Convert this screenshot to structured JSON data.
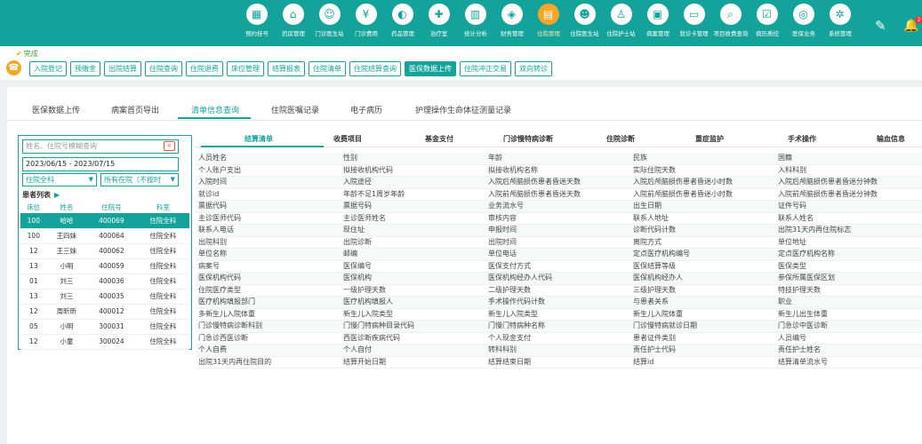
{
  "nav": [
    {
      "label": "预约挂号",
      "icon": "calendar-icon"
    },
    {
      "label": "药房管理",
      "icon": "pharmacy-icon"
    },
    {
      "label": "门诊医生站",
      "icon": "doctor-icon"
    },
    {
      "label": "门诊费用",
      "icon": "fee-icon"
    },
    {
      "label": "药品管理",
      "icon": "pill-icon"
    },
    {
      "label": "治疗室",
      "icon": "treatment-icon"
    },
    {
      "label": "统计分析",
      "icon": "chart-icon"
    },
    {
      "label": "财务管理",
      "icon": "finance-icon"
    },
    {
      "label": "住院管理",
      "icon": "inpatient-icon",
      "active": true
    },
    {
      "label": "住院医生站",
      "icon": "inpatient-doctor-icon"
    },
    {
      "label": "住院护士站",
      "icon": "nurse-icon"
    },
    {
      "label": "病案管理",
      "icon": "record-icon"
    },
    {
      "label": "就诊卡管理",
      "icon": "card-icon"
    },
    {
      "label": "项目收费查询",
      "icon": "query-icon"
    },
    {
      "label": "病历质控",
      "icon": "quality-icon"
    },
    {
      "label": "医保业务",
      "icon": "insurance-icon"
    },
    {
      "label": "系统管理",
      "icon": "settings-icon"
    }
  ],
  "topbar": {
    "badge": "2"
  },
  "toolbar": {
    "status": "完成",
    "buttons": [
      "入院登记",
      "预缴金",
      "出院结算",
      "住院查询",
      "住院退费",
      "床位管理",
      "结算报表",
      "住院清单",
      "住院结算查询",
      "医保数据上传",
      "住院冲正交易",
      "双向转诊"
    ],
    "active_index": 9
  },
  "subtabs": [
    "医保数据上传",
    "病案首页导出",
    "清单信息查询",
    "住院医嘱记录",
    "电子病历",
    "护理操作生命体征测量记录"
  ],
  "subtab_active": 2,
  "left": {
    "search_placeholder": "姓名、住院号模糊查询",
    "date_range": "2023/06/15 - 2023/07/15",
    "dept_select": "住院全科",
    "status_select": "所有在院（不按时",
    "list_title": "患者列表",
    "columns": [
      "床位",
      "姓名",
      "住院号",
      "科室"
    ],
    "rows": [
      [
        "100",
        "哈哈",
        "400069",
        "住院全科"
      ],
      [
        "100",
        "王四妹",
        "400064",
        "住院全科"
      ],
      [
        "12",
        "王三妹",
        "400062",
        "住院全科"
      ],
      [
        "13",
        "小明",
        "400059",
        "住院全科"
      ],
      [
        "01",
        "刘三",
        "400036",
        "住院全科"
      ],
      [
        "13",
        "刘三",
        "400035",
        "住院全科"
      ],
      [
        "12",
        "周昕昕",
        "400012",
        "住院全科"
      ],
      [
        "05",
        "小明",
        "300031",
        "住院全科"
      ],
      [
        "12",
        "小童",
        "300024",
        "住院全科"
      ]
    ],
    "selected_row": 0
  },
  "grid_tabs": [
    "结算清单",
    "收费项目",
    "基金支付",
    "门诊慢特病诊断",
    "住院诊断",
    "重症监护",
    "手术操作",
    "输血信息"
  ],
  "grid_tab_active": 0,
  "grid_rows": [
    [
      "人员姓名",
      "性别",
      "年龄",
      "民族",
      "国籍"
    ],
    [
      "个人账户支出",
      "拟接收机构代码",
      "拟接收机构名称",
      "实际住院天数",
      "入科科别"
    ],
    [
      "入院时间",
      "入院途径",
      "入院后颅脑损伤患者昏迷天数",
      "入院后颅脑损伤患者昏迷小时数",
      "入院后颅脑损伤患者昏迷分钟数"
    ],
    [
      "就诊id",
      "年龄不足1周岁年龄",
      "入院前颅脑损伤患者昏迷天数",
      "入院前颅脑损伤患者昏迷小时数",
      "入院前颅脑损伤患者昏迷分钟数"
    ],
    [
      "票据代码",
      "票据号码",
      "业务流水号",
      "出生日期",
      "证件号码"
    ],
    [
      "主诊医师代码",
      "主诊医师姓名",
      "审核内容",
      "联系人地址",
      "联系人姓名"
    ],
    [
      "联系人电话",
      "现住址",
      "申报时间",
      "诊断代码计数",
      "出院31天内再住院标志"
    ],
    [
      "出院科别",
      "出院诊断",
      "出院时间",
      "离院方式",
      "单位地址"
    ],
    [
      "单位名称",
      "邮编",
      "单位电话",
      "定点医疗机构编号",
      "定点医疗机构名称"
    ],
    [
      "病案号",
      "医保编号",
      "医保支付方式",
      "医保结算等级",
      "医保类型"
    ],
    [
      "医保机构代码",
      "医保机构",
      "医保机构经办人代码",
      "医保机构经办人",
      "参保所属医保区划"
    ],
    [
      "住院医疗类型",
      "一级护理天数",
      "二级护理天数",
      "三级护理天数",
      "特技护理天数"
    ],
    [
      "医疗机构填报部门",
      "医疗机构填报人",
      "手术操作代码计数",
      "与患者关系",
      "职业"
    ],
    [
      "多新生儿入院体重",
      "新生儿入院类型",
      "新生儿入院类型",
      "新生儿入院体重",
      "新生儿出生体重"
    ],
    [
      "门诊慢特病诊断科别",
      "门慢门特病种目录代码",
      "门慢门特病种名称",
      "门诊慢特病就诊日期",
      "门急诊中医诊断"
    ],
    [
      "门急诊西医诊断",
      "西医诊断疾病代码",
      "个人现金支付",
      "患者证件类别",
      "人员编号"
    ],
    [
      "个人自费",
      "个人自付",
      "转科科别",
      "责任护士代码",
      "责任护士姓名"
    ],
    [
      "出院31天内再住院目的",
      "结算开始日期",
      "结算结束日期",
      "结算id",
      "结算清单流水号"
    ]
  ],
  "colors": {
    "teal": "#14a39a",
    "orange": "#f5a623",
    "red": "#e53935"
  }
}
